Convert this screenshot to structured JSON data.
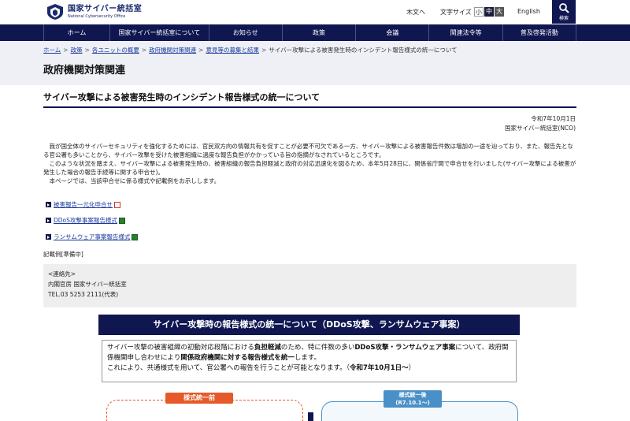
{
  "header": {
    "logo_jp": "国家サイバー統括室",
    "logo_en": "National Cybersecurity Office",
    "kinomoto": "木文へ",
    "text_size_label": "文字サイズ",
    "size_small": "小",
    "size_medium": "中",
    "size_large": "大",
    "english": "English",
    "search_label": "検索"
  },
  "nav": {
    "items": [
      "ホーム",
      "国家サイバー統括室について",
      "お知らせ",
      "政策",
      "会議",
      "関連法令等",
      "普及啓発活動"
    ]
  },
  "breadcrumb": {
    "items": [
      "ホーム",
      "政策",
      "各ユニットの概要",
      "政府機関対策関連",
      "意見等の募集と結果"
    ],
    "current": "サイバー攻撃による被害発生時のインシデント報告様式の統一について"
  },
  "section_title": "政府機関対策関連",
  "page_title": "サイバー攻撃による被害発生時のインシデント報告様式の統一について",
  "date": "令和7年10月1日",
  "org": "国家サイバー統括室(NCO)",
  "body": [
    "我が国全体のサイバーセキュリティを強化するためには、官民双方向の情報共有を促すことが必要不可欠である一方、サイバー攻撃による被害報告件数は増加の一途を辿っており、また、報告先となる官公署も多いことから、サイバー攻撃を受けた被害組織に過度な報告負担がかかっている旨の指摘がなされているところです。",
    "このような状況を踏まえ、サイバー攻撃による被害発生時の、被害組織の報告負担軽減と政府の対応迅速化を図るため、本年5月28日に、関係省庁間で申合せを行いました(サイバー攻撃による被害が発生した場合の報告手続等に関する申合せ)。",
    "本ページでは、当該申合せに係る様式や記載例をお示しします。"
  ],
  "links": [
    {
      "label": "被害報告一元化申合せ",
      "type": "pdf"
    },
    {
      "label": "DDoS攻撃事案報告様式",
      "type": "xls"
    },
    {
      "label": "ランサムウェア事案報告様式",
      "type": "xls"
    }
  ],
  "reiki": "記載例[準備中]",
  "contact": {
    "title": "<連絡先>",
    "org": "内閣官房 国家サイバー統括室",
    "tel": "TEL.03 5253 2111(代表)"
  },
  "infographic": {
    "title": "サイバー攻撃時の報告様式の統一について（DDoS攻撃、ランサムウェア事案）",
    "line1_a": "サイバー攻撃の被害組織の初動対応段階における",
    "line1_b": "負担軽減",
    "line1_c": "のため、特に件数の多い",
    "line1_d": "DDoS攻撃・ランサムウェア事案",
    "line2_a": "について、政府関係機関申し合わせにより",
    "line2_b": "関係政府機関に対する報告様式を統一",
    "line2_c": "します。",
    "line3_a": "これにより、共通様式を用いて、官公署への報告を行うことが可能となります。（",
    "line3_b": "令和7年10月1日〜",
    "line3_c": "）",
    "before": "様式統一前",
    "after_1": "様式統一後",
    "after_2": "(R7.10.1〜)"
  }
}
